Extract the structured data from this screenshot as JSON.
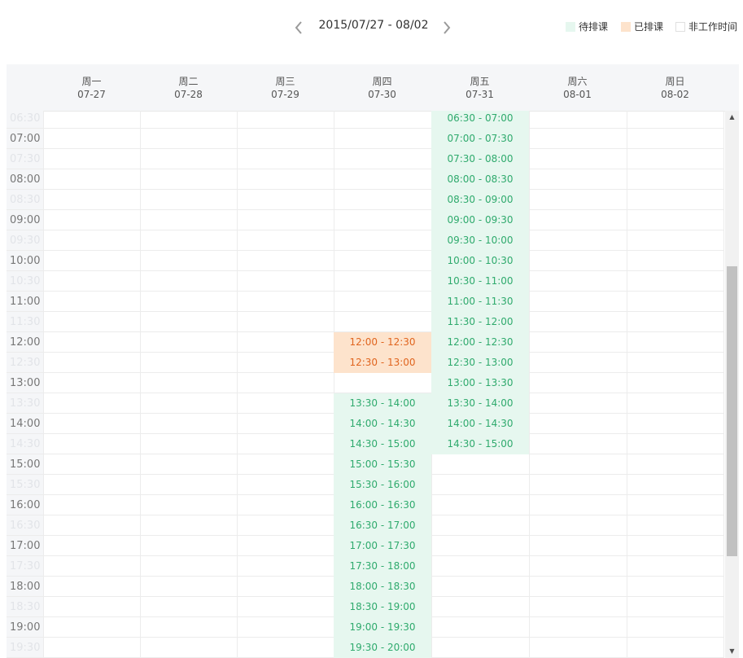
{
  "toolbar": {
    "date_range": "2015/07/27 - 08/02",
    "prev_icon": "chevron-left-icon",
    "next_icon": "chevron-right-icon"
  },
  "legend": {
    "pending": "待排课",
    "scheduled": "已排课",
    "off": "非工作时间"
  },
  "colors": {
    "pending_bg": "#e6f7ef",
    "pending_text": "#2faa6d",
    "scheduled_bg": "#fde3cc",
    "scheduled_text": "#e0651f"
  },
  "days": [
    {
      "weekday": "周一",
      "date": "07-27"
    },
    {
      "weekday": "周二",
      "date": "07-28"
    },
    {
      "weekday": "周三",
      "date": "07-29"
    },
    {
      "weekday": "周四",
      "date": "07-30"
    },
    {
      "weekday": "周五",
      "date": "07-31"
    },
    {
      "weekday": "周六",
      "date": "08-01"
    },
    {
      "weekday": "周日",
      "date": "08-02"
    }
  ],
  "times": [
    "06:30",
    "07:00",
    "07:30",
    "08:00",
    "08:30",
    "09:00",
    "09:30",
    "10:00",
    "10:30",
    "11:00",
    "11:30",
    "12:00",
    "12:30",
    "13:00",
    "13:30",
    "14:00",
    "14:30",
    "15:00",
    "15:30",
    "16:00",
    "16:30",
    "17:00",
    "17:30",
    "18:00",
    "18:30",
    "19:00",
    "19:30"
  ],
  "slots": [
    {
      "day": 4,
      "row": 0,
      "label": "06:30 - 07:00",
      "status": "pending"
    },
    {
      "day": 4,
      "row": 1,
      "label": "07:00 - 07:30",
      "status": "pending"
    },
    {
      "day": 4,
      "row": 2,
      "label": "07:30 - 08:00",
      "status": "pending"
    },
    {
      "day": 4,
      "row": 3,
      "label": "08:00 - 08:30",
      "status": "pending"
    },
    {
      "day": 4,
      "row": 4,
      "label": "08:30 - 09:00",
      "status": "pending"
    },
    {
      "day": 4,
      "row": 5,
      "label": "09:00 - 09:30",
      "status": "pending"
    },
    {
      "day": 4,
      "row": 6,
      "label": "09:30 - 10:00",
      "status": "pending"
    },
    {
      "day": 4,
      "row": 7,
      "label": "10:00 - 10:30",
      "status": "pending"
    },
    {
      "day": 4,
      "row": 8,
      "label": "10:30 - 11:00",
      "status": "pending"
    },
    {
      "day": 4,
      "row": 9,
      "label": "11:00 - 11:30",
      "status": "pending"
    },
    {
      "day": 4,
      "row": 10,
      "label": "11:30 - 12:00",
      "status": "pending"
    },
    {
      "day": 4,
      "row": 11,
      "label": "12:00 - 12:30",
      "status": "pending"
    },
    {
      "day": 4,
      "row": 12,
      "label": "12:30 - 13:00",
      "status": "pending"
    },
    {
      "day": 4,
      "row": 13,
      "label": "13:00 - 13:30",
      "status": "pending"
    },
    {
      "day": 4,
      "row": 14,
      "label": "13:30 - 14:00",
      "status": "pending"
    },
    {
      "day": 4,
      "row": 15,
      "label": "14:00 - 14:30",
      "status": "pending"
    },
    {
      "day": 4,
      "row": 16,
      "label": "14:30 - 15:00",
      "status": "pending"
    },
    {
      "day": 3,
      "row": 11,
      "label": "12:00 - 12:30",
      "status": "scheduled"
    },
    {
      "day": 3,
      "row": 12,
      "label": "12:30 - 13:00",
      "status": "scheduled"
    },
    {
      "day": 3,
      "row": 14,
      "label": "13:30 - 14:00",
      "status": "pending"
    },
    {
      "day": 3,
      "row": 15,
      "label": "14:00 - 14:30",
      "status": "pending"
    },
    {
      "day": 3,
      "row": 16,
      "label": "14:30 - 15:00",
      "status": "pending"
    },
    {
      "day": 3,
      "row": 17,
      "label": "15:00 - 15:30",
      "status": "pending"
    },
    {
      "day": 3,
      "row": 18,
      "label": "15:30 - 16:00",
      "status": "pending"
    },
    {
      "day": 3,
      "row": 19,
      "label": "16:00 - 16:30",
      "status": "pending"
    },
    {
      "day": 3,
      "row": 20,
      "label": "16:30 - 17:00",
      "status": "pending"
    },
    {
      "day": 3,
      "row": 21,
      "label": "17:00 - 17:30",
      "status": "pending"
    },
    {
      "day": 3,
      "row": 22,
      "label": "17:30 - 18:00",
      "status": "pending"
    },
    {
      "day": 3,
      "row": 23,
      "label": "18:00 - 18:30",
      "status": "pending"
    },
    {
      "day": 3,
      "row": 24,
      "label": "18:30 - 19:00",
      "status": "pending"
    },
    {
      "day": 3,
      "row": 25,
      "label": "19:00 - 19:30",
      "status": "pending"
    },
    {
      "day": 3,
      "row": 26,
      "label": "19:30 - 20:00",
      "status": "pending"
    }
  ]
}
